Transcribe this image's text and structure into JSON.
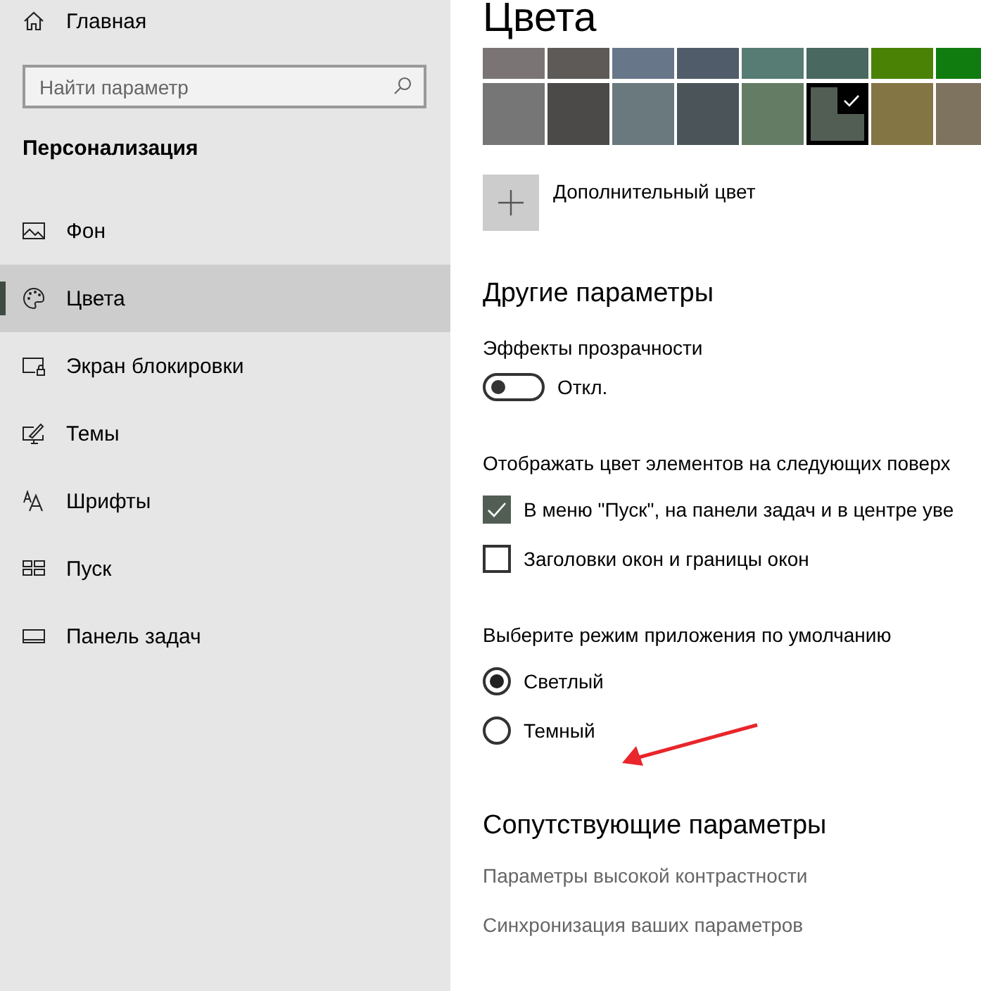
{
  "sidebar": {
    "home": {
      "label": "Главная"
    },
    "search": {
      "placeholder": "Найти параметр"
    },
    "section_title": "Персонализация",
    "items": [
      {
        "label": "Фон",
        "selected": false
      },
      {
        "label": "Цвета",
        "selected": true
      },
      {
        "label": "Экран блокировки",
        "selected": false
      },
      {
        "label": "Темы",
        "selected": false
      },
      {
        "label": "Шрифты",
        "selected": false
      },
      {
        "label": "Пуск",
        "selected": false
      },
      {
        "label": "Панель задач",
        "selected": false
      }
    ]
  },
  "main": {
    "title": "Цвета",
    "accent_colors": [
      [
        {
          "color": "#7a7574",
          "selected": false
        },
        {
          "color": "#5d5a58",
          "selected": false
        },
        {
          "color": "#68768a",
          "selected": false
        },
        {
          "color": "#515c6b",
          "selected": false
        },
        {
          "color": "#567c73",
          "selected": false
        },
        {
          "color": "#486860",
          "selected": false
        },
        {
          "color": "#498205",
          "selected": false
        },
        {
          "color": "#107c10",
          "selected": false
        }
      ],
      [
        {
          "color": "#767676",
          "selected": false
        },
        {
          "color": "#4c4a48",
          "selected": false
        },
        {
          "color": "#69797e",
          "selected": false
        },
        {
          "color": "#4a5459",
          "selected": false
        },
        {
          "color": "#647c64",
          "selected": false
        },
        {
          "color": "#525e54",
          "selected": true
        },
        {
          "color": "#847545",
          "selected": false
        },
        {
          "color": "#7e735f",
          "selected": false
        }
      ]
    ],
    "custom_color": {
      "label": "Дополнительный цвет"
    },
    "other": {
      "heading": "Другие параметры",
      "transparency": {
        "label": "Эффекты прозрачности",
        "on": false,
        "state_label": "Откл."
      },
      "surfaces": {
        "label": "Отображать цвет элементов на следующих поверх",
        "options": [
          {
            "label": "В меню \"Пуск\", на панели задач и в центре уве",
            "checked": true
          },
          {
            "label": "Заголовки окон и границы окон",
            "checked": false
          }
        ]
      },
      "app_mode": {
        "label": "Выберите режим приложения по умолчанию",
        "options": [
          {
            "label": "Светлый",
            "selected": true
          },
          {
            "label": "Темный",
            "selected": false
          }
        ]
      }
    },
    "related": {
      "heading": "Сопутствующие параметры",
      "links": [
        "Параметры высокой контрастности",
        "Синхронизация ваших параметров"
      ]
    }
  }
}
